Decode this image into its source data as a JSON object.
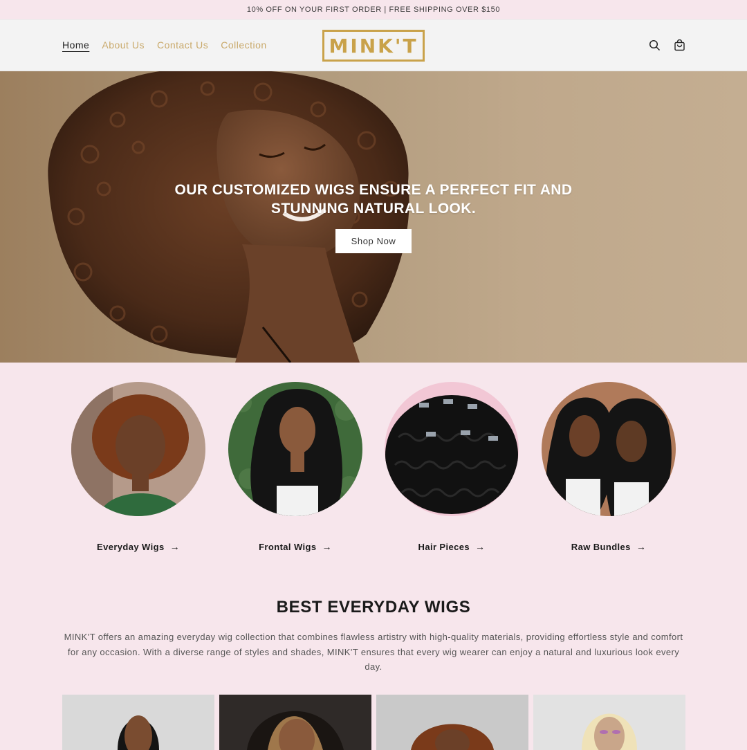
{
  "announcement": "10% OFF ON YOUR FIRST ORDER | FREE SHIPPING OVER $150",
  "nav": {
    "items": [
      "Home",
      "About Us",
      "Contact Us",
      "Collection"
    ]
  },
  "logo_text": "MINK'T",
  "icons": {
    "search": "search-icon",
    "cart": "cart-icon"
  },
  "hero": {
    "title": "OUR CUSTOMIZED WIGS ENSURE A PERFECT FIT AND STUNNING NATURAL LOOK.",
    "button": "Shop Now"
  },
  "categories": [
    {
      "label": "Everyday Wigs"
    },
    {
      "label": "Frontal Wigs"
    },
    {
      "label": "Hair Pieces"
    },
    {
      "label": "Raw Bundles"
    }
  ],
  "best": {
    "title": "BEST EVERYDAY WIGS",
    "description": "MINK'T offers an amazing everyday wig collection that combines flawless artistry with high-quality materials, providing effortless style and comfort for any occasion. With a diverse range of styles and shades, MINK'T ensures that every wig wearer can enjoy a natural and luxurious look every day."
  },
  "colors": {
    "accent_gold": "#c9a24a",
    "nav_gold": "#c9a96a",
    "page_pink": "#f7e6ec"
  }
}
